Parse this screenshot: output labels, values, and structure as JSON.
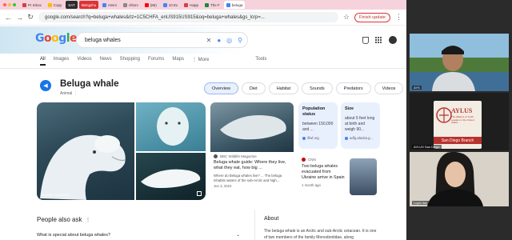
{
  "browser": {
    "tabs": [
      {
        "label": "Pr Inbox"
      },
      {
        "label": "Copy"
      },
      {
        "label": "SAT"
      },
      {
        "label": "Mengzhu"
      },
      {
        "label": "Hemi"
      },
      {
        "label": "chlorv"
      },
      {
        "label": "(85)"
      },
      {
        "label": "10 Ex"
      },
      {
        "label": "Happ"
      },
      {
        "label": "The F"
      },
      {
        "label": "beluga"
      }
    ],
    "url": "google.com/search?q=beluga+whales&rlz=1C5CHFA_enUS915US915&oq=beluga+whales&gs_lcrp=...",
    "finish_update": "Finish update",
    "colors": {
      "tabstrip": "#f6d3dc",
      "finish": "#d33333"
    }
  },
  "search": {
    "logo": "Google",
    "query": "beluga whales",
    "nav_tabs": [
      "All",
      "Images",
      "Videos",
      "News",
      "Shopping",
      "Forums",
      "Maps",
      "More"
    ],
    "tools": "Tools"
  },
  "entity": {
    "title": "Beluga whale",
    "subtitle": "Animal",
    "chips": [
      "Overview",
      "Diet",
      "Habitat",
      "Sounds",
      "Predators",
      "Videos"
    ]
  },
  "images": {
    "main_credit": "Georgia Aquarium"
  },
  "cards": {
    "bbc": {
      "source": "BBC Wildlife Magazine",
      "title": "Beluga whale guide: Where they live, what they eat, how big ...",
      "snippet": "Where do Beluga whales live? ... The beluga inhabits waters of the sub-Arctic and high...",
      "date": "Jun 3, 2024"
    },
    "population": {
      "title": "Population status",
      "value": "between 150,000 and ...",
      "source": "iflwf.org"
    },
    "size": {
      "title": "Size",
      "value": "about 5 feet long at birth and weigh 90...",
      "source": "adfg.alaska.g..."
    },
    "cnn": {
      "source": "CNN",
      "title": "Two beluga whales evacuated from Ukraine arrive in Spain",
      "date": "1 month ago"
    }
  },
  "paa": {
    "heading": "People also ask",
    "question": "What is special about beluga whales?"
  },
  "about": {
    "heading": "About",
    "text": "The beluga whale is an Arctic and sub-Arctic cetacean. It is one of two members of the family Monodontidae, along"
  },
  "meeting": {
    "tile1_name": "AYS",
    "aylus_title": "AYLUS",
    "aylus_subtitle": "The Alliance of Youth Leaders in the United States",
    "aylus_branch": "San Diego Branch",
    "tile2_name": "AYLUS San Diego",
    "tile3_name": "Lupin lian"
  }
}
